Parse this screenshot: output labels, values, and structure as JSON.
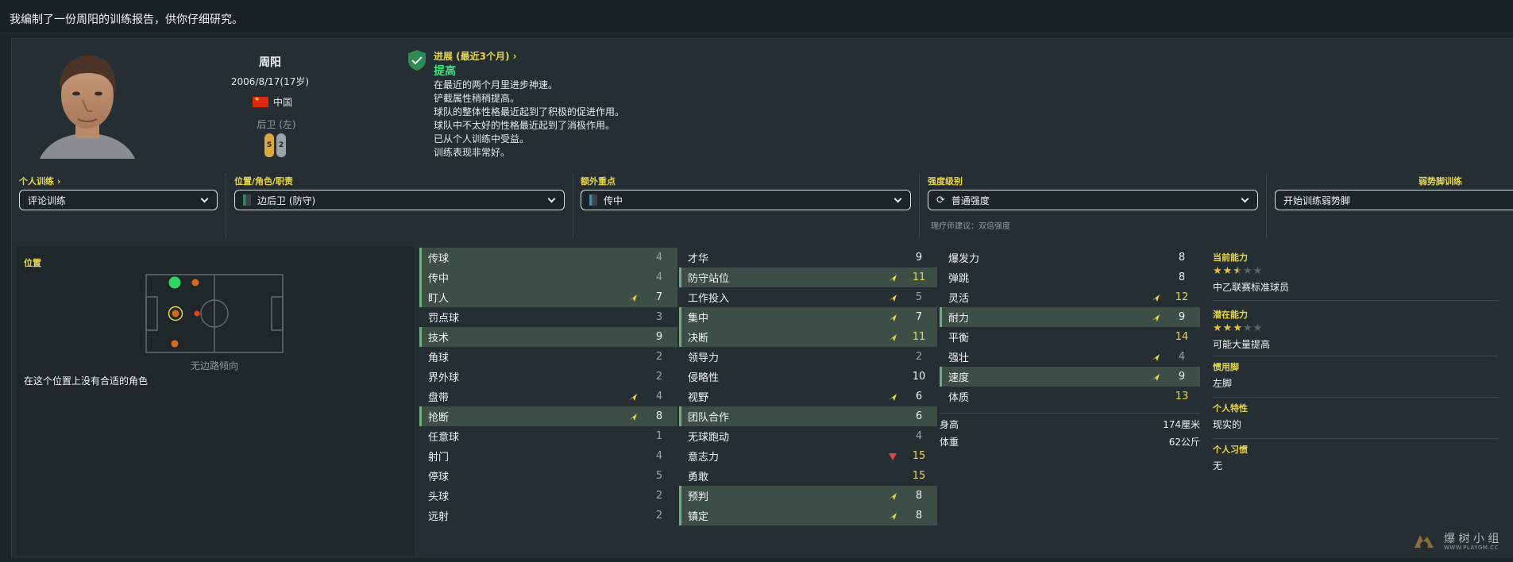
{
  "message": "我编制了一份周阳的训练报告，供你仔细研究。",
  "player": {
    "name": "周阳",
    "dob": "2006/8/17(17岁)",
    "nationality": "中国",
    "position": "后卫 (左)",
    "left_foot": "5",
    "right_foot": "2"
  },
  "progress": {
    "heading": "进展 (最近3个月)",
    "status": "提高",
    "lines": [
      "在最近的两个月里进步神速。",
      "铲截属性稍稍提高。",
      "球队的整体性格最近起到了积极的促进作用。",
      "球队中不太好的性格最近起到了消极作用。",
      "已从个人训练中受益。",
      "训练表现非常好。"
    ]
  },
  "controls": {
    "individual_label": "个人训练",
    "individual_value": "评论训练",
    "role_label": "位置/角色/职责",
    "role_value": "边后卫 (防守)",
    "focus_label": "额外重点",
    "focus_value": "传中",
    "intensity_label": "强度级别",
    "intensity_value": "普通强度",
    "coach_hint": "理疗师建议：双倍强度",
    "weakfoot_label": "弱势脚训练",
    "weakfoot_value": "开始训练弱势脚"
  },
  "position_panel": {
    "title": "位置",
    "caption": "无边路倾向",
    "note": "在这个位置上没有合适的角色"
  },
  "technical": [
    {
      "name": "传球",
      "value": "4",
      "hl": true,
      "arrow": "",
      "color": "grey"
    },
    {
      "name": "传中",
      "value": "4",
      "hl": true,
      "arrow": "",
      "color": "grey"
    },
    {
      "name": "盯人",
      "value": "7",
      "hl": true,
      "arrow": "up",
      "color": "white"
    },
    {
      "name": "罚点球",
      "value": "3",
      "hl": false,
      "arrow": "",
      "color": "grey"
    },
    {
      "name": "技术",
      "value": "9",
      "hl": true,
      "arrow": "",
      "color": "white"
    },
    {
      "name": "角球",
      "value": "2",
      "hl": false,
      "arrow": "",
      "color": "grey"
    },
    {
      "name": "界外球",
      "value": "2",
      "hl": false,
      "arrow": "",
      "color": "grey"
    },
    {
      "name": "盘带",
      "value": "4",
      "hl": false,
      "arrow": "up",
      "color": "grey"
    },
    {
      "name": "抢断",
      "value": "8",
      "hl": true,
      "arrow": "up",
      "color": "white"
    },
    {
      "name": "任意球",
      "value": "1",
      "hl": false,
      "arrow": "",
      "color": "grey"
    },
    {
      "name": "射门",
      "value": "4",
      "hl": false,
      "arrow": "",
      "color": "grey"
    },
    {
      "name": "停球",
      "value": "5",
      "hl": false,
      "arrow": "",
      "color": "grey"
    },
    {
      "name": "头球",
      "value": "2",
      "hl": false,
      "arrow": "",
      "color": "grey"
    },
    {
      "name": "远射",
      "value": "2",
      "hl": false,
      "arrow": "",
      "color": "grey"
    }
  ],
  "mental": [
    {
      "name": "才华",
      "value": "9",
      "hl": false,
      "arrow": "",
      "color": "white"
    },
    {
      "name": "防守站位",
      "value": "11",
      "hl": true,
      "arrow": "up",
      "color": "yellow"
    },
    {
      "name": "工作投入",
      "value": "5",
      "hl": false,
      "arrow": "up",
      "color": "grey"
    },
    {
      "name": "集中",
      "value": "7",
      "hl": true,
      "arrow": "up",
      "color": "white"
    },
    {
      "name": "决断",
      "value": "11",
      "hl": true,
      "arrow": "up",
      "color": "yellow"
    },
    {
      "name": "领导力",
      "value": "2",
      "hl": false,
      "arrow": "",
      "color": "grey"
    },
    {
      "name": "侵略性",
      "value": "10",
      "hl": false,
      "arrow": "",
      "color": "white"
    },
    {
      "name": "视野",
      "value": "6",
      "hl": false,
      "arrow": "up",
      "color": "white"
    },
    {
      "name": "团队合作",
      "value": "6",
      "hl": true,
      "arrow": "",
      "color": "white"
    },
    {
      "name": "无球跑动",
      "value": "4",
      "hl": false,
      "arrow": "",
      "color": "grey"
    },
    {
      "name": "意志力",
      "value": "15",
      "hl": false,
      "arrow": "down",
      "color": "yellow"
    },
    {
      "name": "勇敢",
      "value": "15",
      "hl": false,
      "arrow": "",
      "color": "yellow"
    },
    {
      "name": "预判",
      "value": "8",
      "hl": true,
      "arrow": "up",
      "color": "white"
    },
    {
      "name": "镇定",
      "value": "8",
      "hl": true,
      "arrow": "up",
      "color": "white"
    }
  ],
  "physical": [
    {
      "name": "爆发力",
      "value": "8",
      "hl": false,
      "arrow": "",
      "color": "white"
    },
    {
      "name": "弹跳",
      "value": "8",
      "hl": false,
      "arrow": "",
      "color": "white"
    },
    {
      "name": "灵活",
      "value": "12",
      "hl": false,
      "arrow": "up",
      "color": "yellow"
    },
    {
      "name": "耐力",
      "value": "9",
      "hl": true,
      "arrow": "up",
      "color": "white"
    },
    {
      "name": "平衡",
      "value": "14",
      "hl": false,
      "arrow": "",
      "color": "yellow"
    },
    {
      "name": "强壮",
      "value": "4",
      "hl": false,
      "arrow": "up",
      "color": "grey"
    },
    {
      "name": "速度",
      "value": "9",
      "hl": true,
      "arrow": "up",
      "color": "white"
    },
    {
      "name": "体质",
      "value": "13",
      "hl": false,
      "arrow": "",
      "color": "yellow"
    }
  ],
  "body": {
    "height_label": "身高",
    "height_value": "174厘米",
    "weight_label": "体重",
    "weight_value": "62公斤"
  },
  "side": {
    "current_ability_label": "当前能力",
    "current_ability_stars": 2.5,
    "current_ability_text": "中乙联赛标准球员",
    "potential_label": "潜在能力",
    "potential_stars": 3,
    "potential_text": "可能大量提高",
    "foot_label": "惯用脚",
    "foot_value": "左脚",
    "trait_label": "个人特性",
    "trait_value": "现实的",
    "habit_label": "个人习惯",
    "habit_value": "无"
  },
  "watermark": {
    "text": "爆 树 小 组",
    "url": "WWW.PLAYGM.CC"
  }
}
